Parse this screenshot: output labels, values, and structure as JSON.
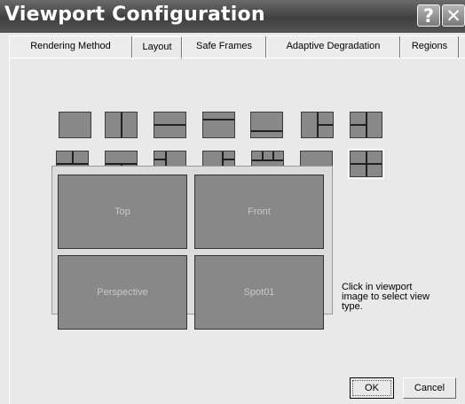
{
  "window": {
    "title": "Viewport Configuration",
    "help_label": "?",
    "close_label": "✕"
  },
  "tabs": [
    {
      "label": "Rendering Method"
    },
    {
      "label": "Layout"
    },
    {
      "label": "Safe Frames"
    },
    {
      "label": "Adaptive Degradation"
    },
    {
      "label": "Regions"
    }
  ],
  "active_tab": "Layout",
  "layout_options": [
    {
      "icon": "layout-single-icon"
    },
    {
      "icon": "layout-two-vertical-icon"
    },
    {
      "icon": "layout-two-horizontal-icon"
    },
    {
      "icon": "layout-top-strip-icon"
    },
    {
      "icon": "layout-bottom-strip-icon"
    },
    {
      "icon": "layout-three-right-split-icon"
    },
    {
      "icon": "layout-three-left-split-icon"
    },
    {
      "icon": "layout-two-top-one-bottom-icon"
    },
    {
      "icon": "layout-one-top-two-bottom-icon"
    },
    {
      "icon": "layout-three-left-column-icon"
    },
    {
      "icon": "layout-three-right-column-icon"
    },
    {
      "icon": "layout-three-top-row-icon"
    },
    {
      "icon": "layout-three-bottom-row-icon"
    },
    {
      "icon": "layout-four-equal-icon"
    }
  ],
  "selected_layout": "layout-four-equal-icon",
  "viewports": [
    {
      "label": "Top"
    },
    {
      "label": "Front"
    },
    {
      "label": "Perspective"
    },
    {
      "label": "Spot01"
    }
  ],
  "hint": "Click in viewport image to select view type.",
  "buttons": {
    "ok": "OK",
    "cancel": "Cancel"
  },
  "colors": {
    "title_bar": "#4a4a4a",
    "dialog_bg": "#e9e9e9",
    "viewport_fill": "#888888",
    "viewport_text": "#c8c8c8"
  }
}
